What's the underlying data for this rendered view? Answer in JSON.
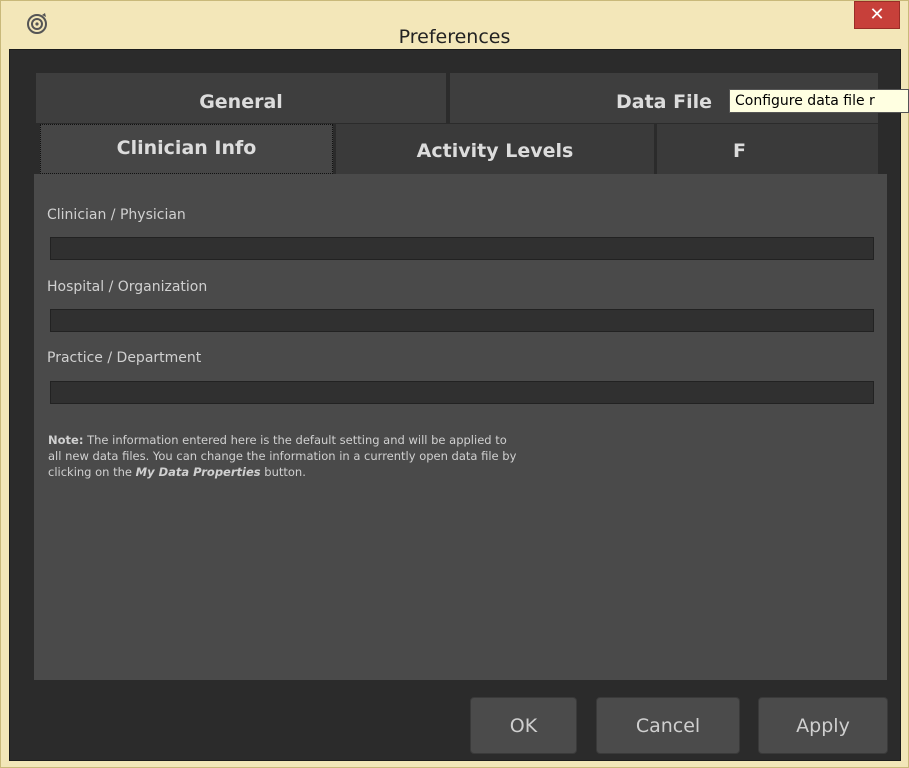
{
  "window": {
    "title": "Preferences",
    "close_label": "✕"
  },
  "tabs": {
    "row1": [
      {
        "label": "General"
      },
      {
        "label": "Data File"
      }
    ],
    "row2": [
      {
        "label": "Clinician Info",
        "selected": true
      },
      {
        "label": "Activity Levels"
      },
      {
        "label": "F"
      }
    ]
  },
  "tooltip": {
    "text": "Configure data file r"
  },
  "form": {
    "clinician_label": "Clinician / Physician",
    "clinician_value": "",
    "hospital_label": "Hospital / Organization",
    "hospital_value": "",
    "practice_label": "Practice / Department",
    "practice_value": ""
  },
  "note": {
    "prefix": "Note:",
    "line1_rest": " The information entered here is the default setting and will be applied to",
    "line2": "all new data files. You can change the information in a currently open data file by",
    "line3_before": "clicking on the ",
    "line3_emph": "My Data Properties",
    "line3_after": " button."
  },
  "buttons": {
    "ok": "OK",
    "cancel": "Cancel",
    "apply": "Apply"
  },
  "colors": {
    "titlebar": "#f3e7b9",
    "close": "#c7403a",
    "dialog_bg": "#2b2b2b",
    "panel_bg": "#4a4a4a"
  }
}
